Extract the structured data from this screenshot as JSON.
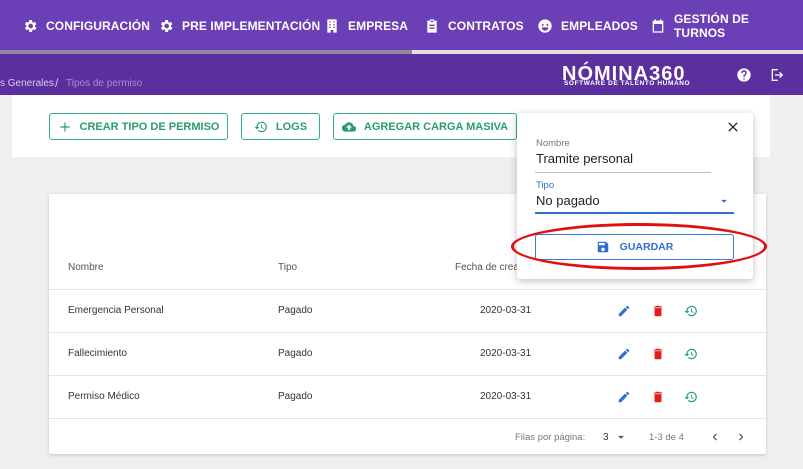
{
  "nav": {
    "items": [
      {
        "label": "CONFIGURACIÓN",
        "icon": "gear-icon"
      },
      {
        "label": "PRE IMPLEMENTACIÓN",
        "icon": "gear-icon"
      },
      {
        "label": "EMPRESA",
        "icon": "building-icon"
      },
      {
        "label": "CONTRATOS",
        "icon": "clipboard-icon"
      },
      {
        "label": "EMPLEADOS",
        "icon": "face-icon"
      },
      {
        "label": "GESTIÓN DE TURNOS",
        "icon": "calendar-icon"
      }
    ]
  },
  "breadcrumb": {
    "parent": "s Generales",
    "separator": "/",
    "current": "Tipos de permiso"
  },
  "logo": {
    "name": "NÓMINA360",
    "tagline": "SOFTWARE DE TALENTO HUMANO"
  },
  "actions": {
    "create": "CREAR TIPO DE PERMISO",
    "logs": "LOGS",
    "bulk": "AGREGAR CARGA MASIVA"
  },
  "table": {
    "headers": [
      "Nombre",
      "Tipo",
      "Fecha de crea"
    ],
    "rows": [
      {
        "nombre": "Emergencia Personal",
        "tipo": "Pagado",
        "fecha": "2020-03-31"
      },
      {
        "nombre": "Fallecimiento",
        "tipo": "Pagado",
        "fecha": "2020-03-31"
      },
      {
        "nombre": "Permiso Médico",
        "tipo": "Pagado",
        "fecha": "2020-03-31"
      }
    ],
    "footer": {
      "rows_per_page_label": "Filas por página:",
      "rows_per_page_value": "3",
      "range": "1-3 de 4"
    }
  },
  "form": {
    "nombre_label": "Nombre",
    "nombre_value": "Tramite personal",
    "tipo_label": "Tipo",
    "tipo_value": "No pagado",
    "save_label": "GUARDAR"
  },
  "colors": {
    "nav_bg": "#6b3fb5",
    "subbar_bg": "#5c2f9f",
    "accent_green": "#2a9d6b",
    "accent_blue": "#2f6fd0",
    "delete_red": "#e02020",
    "history_teal": "#1a9a8a",
    "annotation_red": "#e01010"
  }
}
